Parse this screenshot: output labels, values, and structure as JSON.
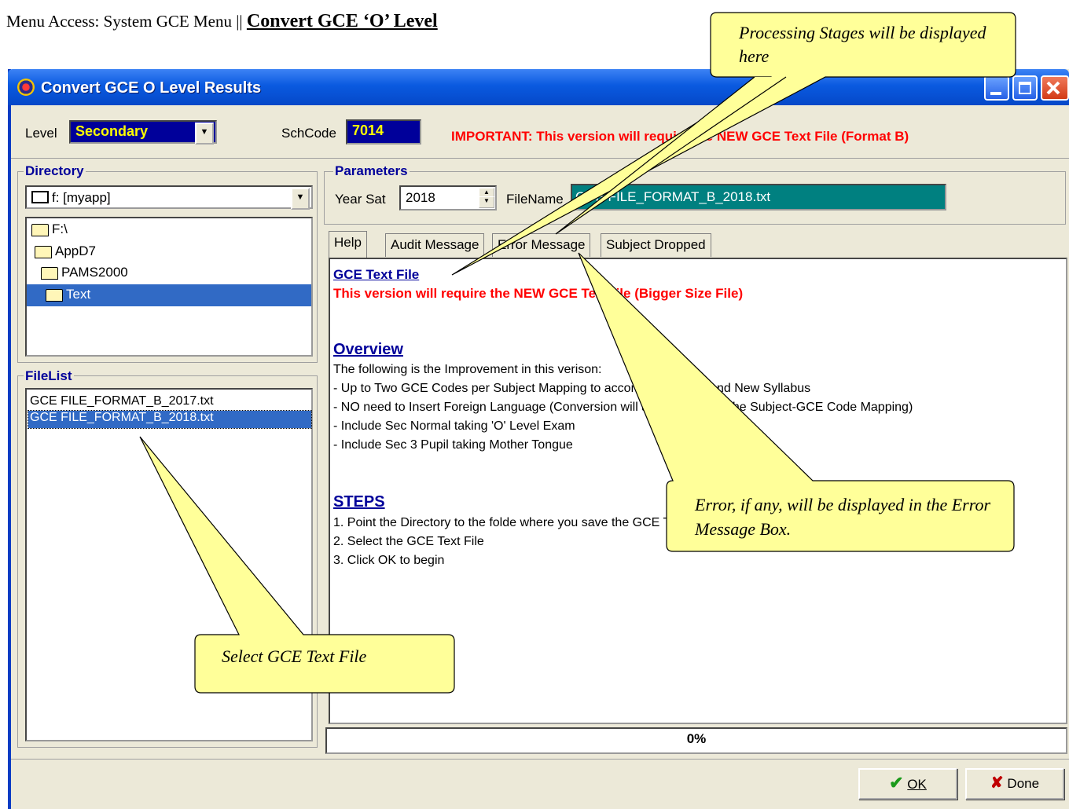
{
  "heading": {
    "prefix": "Menu Access: System GCE Menu || ",
    "emphasis": "Convert GCE ‘O’ Level"
  },
  "window": {
    "title": "Convert GCE O Level Results"
  },
  "top": {
    "level_label": "Level",
    "level_value": "Secondary",
    "schcode_label": "SchCode",
    "schcode_value": "7014",
    "important": "IMPORTANT: This version will require the NEW GCE Text File (Format B)"
  },
  "directory": {
    "title": "Directory",
    "drive": "f: [myapp]",
    "tree": [
      "F:\\",
      "AppD7",
      "PAMS2000",
      "Text"
    ]
  },
  "filelist": {
    "title": "FileList",
    "files": [
      "GCE FILE_FORMAT_B_2017.txt",
      "GCE FILE_FORMAT_B_2018.txt"
    ]
  },
  "parameters": {
    "title": "Parameters",
    "year_label": "Year Sat",
    "year_value": "2018",
    "filename_label": "FileName",
    "filename_value": "GCE FILE_FORMAT_B_2018.txt"
  },
  "tabs": [
    "Help",
    "Audit Message",
    "Error Message",
    "Subject Dropped"
  ],
  "help": {
    "title": "GCE Text File",
    "warning": "This version will require the NEW GCE TextFile (Bigger Size File)",
    "overview_title": "Overview",
    "overview_lines": [
      "The following is the Improvement in this verison:",
      "- Up to Two GCE Codes per Subject Mapping to accommodate Old and New Syllabus",
      "- NO need to Insert Foreign Language (Conversion will auto determine the Subject-GCE Code Mapping)",
      "- Include Sec Normal taking 'O' Level Exam",
      "- Include Sec 3 Pupil taking Mother Tongue"
    ],
    "steps_title": "STEPS",
    "steps": [
      "1. Point the Directory to the folde where you save the GCE Text File",
      "2. Select the GCE Text File",
      "3. Click OK to begin"
    ]
  },
  "progress": {
    "label": "0%",
    "value": 0
  },
  "buttons": {
    "ok": "OK",
    "done": "Done"
  },
  "callouts": {
    "processing": "Processing Stages will be displayed here",
    "error": "Error, if any, will be displayed in the Error Message Box.",
    "select": "Select GCE Text File"
  },
  "colors": {
    "title_bar": "#0a5ae0",
    "callout_fill": "#ffff99",
    "selection": "#316ac5",
    "important_red": "#ff0000",
    "filename_bg": "#008080"
  }
}
